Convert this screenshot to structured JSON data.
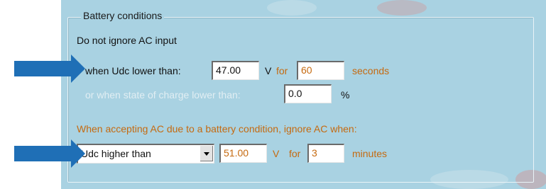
{
  "group_title": "Battery conditions",
  "ignore_label": "Do not ignore AC input",
  "row_udc_low": {
    "prefix": "when Udc lower than:",
    "value": "47.00",
    "unit": "V",
    "for_label": "for",
    "time_value": "60",
    "time_unit": "seconds"
  },
  "row_soc": {
    "prefix": "or when state of charge lower than:",
    "value": "0.0",
    "unit": "%"
  },
  "accept_label": "When accepting AC due to a battery condition, ignore AC when:",
  "row_ignore": {
    "condition_selected": "Udc higher than",
    "value": "51.00",
    "unit": "V",
    "for_label": "for",
    "time_value": "3",
    "time_unit": "minutes"
  },
  "colors": {
    "panel": "#a9d2e2",
    "arrow": "#1f6fb6",
    "accent_orange": "#c56a10"
  }
}
